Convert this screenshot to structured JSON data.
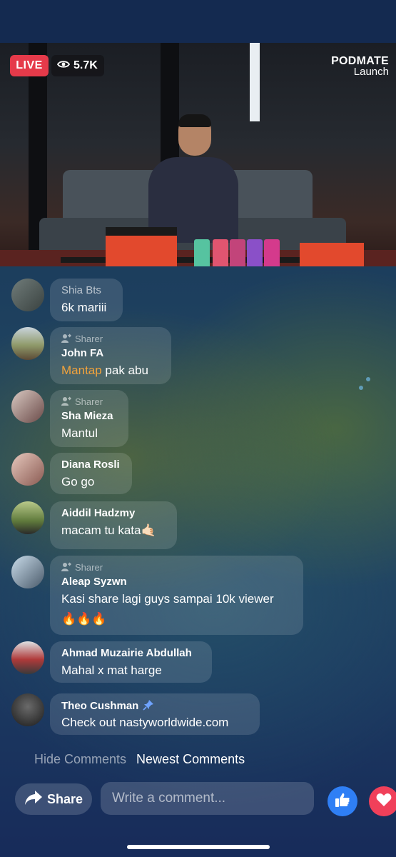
{
  "stream": {
    "live_label": "LIVE",
    "viewer_count": "5.7K",
    "brand_line1": "PODMATE",
    "brand_line2": "Launch"
  },
  "comments": [
    {
      "name": "Shia Bts",
      "sharer": false,
      "text": "6k mariii"
    },
    {
      "name": "John FA",
      "sharer": true,
      "sharer_label": "Sharer",
      "highlight": "Mantap",
      "text": " pak abu"
    },
    {
      "name": "Sha Mieza",
      "sharer": true,
      "sharer_label": "Sharer",
      "text": "Mantul"
    },
    {
      "name": "Diana Rosli",
      "sharer": false,
      "text": "Go go"
    },
    {
      "name": "Aiddil Hadzmy",
      "sharer": false,
      "text": "macam tu kata🤙🏻"
    },
    {
      "name": "Aleap Syzwn",
      "sharer": true,
      "sharer_label": "Sharer",
      "text": "Kasi share lagi guys sampai 10k viewer",
      "text2": "🔥🔥🔥"
    },
    {
      "name": "Ahmad Muzairie Abdullah",
      "sharer": false,
      "text": "Mahal x mat harge"
    },
    {
      "name": "Theo Cushman",
      "sharer": false,
      "pinned": true,
      "text": "Check out nastyworldwide.com"
    }
  ],
  "footer": {
    "hide_comments": "Hide Comments",
    "newest_comments": "Newest Comments",
    "share_label": "Share",
    "comment_placeholder": "Write a comment..."
  },
  "colors": {
    "live": "#e53a4a",
    "like": "#2f7ff5",
    "love": "#f0405a",
    "highlight": "#f2a33c"
  }
}
